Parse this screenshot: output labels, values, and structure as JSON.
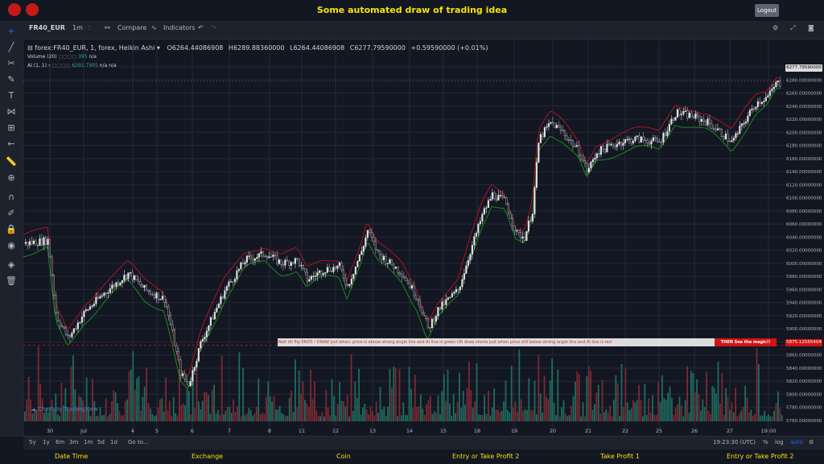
{
  "header": {
    "title": "Some automated draw of trading idea",
    "logout_label": "Logout"
  },
  "toolbar": {
    "symbol": "FR40_EUR",
    "interval": "1m",
    "compare_label": "Compare",
    "indicators_label": "Indicators"
  },
  "legend": {
    "main": "forex:FR40_EUR, 1, forex, Heikin Ashi",
    "open": "O6264.44086908",
    "high": "H6289.88360000",
    "low": "L6264.44086908",
    "close": "C6277.79590000",
    "change": "+0.59590000 (+0.01%)",
    "volume_label": "Volume (20)",
    "volume_val": "395",
    "volume_na": "n/a",
    "ai_label": "AI (1, 1)",
    "ai_val": "6291.7995",
    "ai_na1": "n/a",
    "ai_na2": "n/a"
  },
  "banner": {
    "text": "Wait till flip ENDS  !   DRAW just when:  price is above strong angle line and AI line is green        OR        draw shorts just when price still below strong angle line and AI line is red",
    "cta": "THEN See the magic!!"
  },
  "price_axis": {
    "ticks": [
      "6300.00000000",
      "6280.00000000",
      "6260.00000000",
      "6240.00000000",
      "6220.00000000",
      "6200.00000000",
      "6180.00000000",
      "6160.00000000",
      "6140.00000000",
      "6120.00000000",
      "6100.00000000",
      "6080.00000000",
      "6060.00000000",
      "6040.00000000",
      "6020.00000000",
      "6000.00000000",
      "5980.00000000",
      "5960.00000000",
      "5940.00000000",
      "5920.00000000",
      "5900.00000000",
      "5880.00000000",
      "5860.00000000",
      "5840.00000000",
      "5820.00000000",
      "5800.00000000",
      "5780.00000000",
      "5760.00000000"
    ],
    "last_price": "6277.79590000",
    "line_price": "5875.12565404"
  },
  "time_axis": {
    "labels": [
      "30",
      "Jul",
      "4",
      "5",
      "6",
      "7",
      "8",
      "11",
      "12",
      "13",
      "14",
      "15",
      "18",
      "19",
      "20",
      "21",
      "22",
      "25",
      "26",
      "27",
      "19:00"
    ]
  },
  "bottombar": {
    "ranges": [
      "5y",
      "1y",
      "6m",
      "3m",
      "1m",
      "5d",
      "1d"
    ],
    "goto": "Go to...",
    "clock": "19:23:30 (UTC)",
    "pct": "%",
    "log": "log",
    "auto": "auto"
  },
  "watermark": "Chart by TradingView",
  "footer": {
    "labels": [
      "Date Time",
      "Exchange",
      "Coin",
      "Entry or Take Profit 2",
      "Take Profit 1",
      "Entry or Take Profit 2"
    ]
  },
  "colors": {
    "bg": "#131722",
    "up": "#26a69a",
    "down": "#ef5350",
    "accent": "#f5e30a"
  }
}
